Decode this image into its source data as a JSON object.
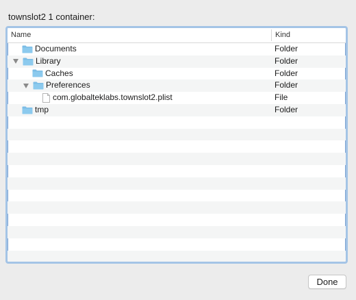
{
  "dialog": {
    "title": "townslot2 1 container:",
    "done_label": "Done"
  },
  "table": {
    "columns": [
      "Name",
      "Kind"
    ],
    "rows": [
      {
        "name": "Documents",
        "kind": "Folder",
        "icon": "folder-icon",
        "expanded": null,
        "depth": 0
      },
      {
        "name": "Library",
        "kind": "Folder",
        "icon": "folder-icon",
        "expanded": true,
        "depth": 0
      },
      {
        "name": "Caches",
        "kind": "Folder",
        "icon": "folder-icon",
        "expanded": null,
        "depth": 1
      },
      {
        "name": "Preferences",
        "kind": "Folder",
        "icon": "folder-icon",
        "expanded": true,
        "depth": 1
      },
      {
        "name": "com.globalteklabs.townslot2.plist",
        "kind": "File",
        "icon": "file-icon",
        "expanded": null,
        "depth": 2
      },
      {
        "name": "tmp",
        "kind": "Folder",
        "icon": "folder-icon",
        "expanded": null,
        "depth": 0
      }
    ]
  },
  "colors": {
    "focus_ring": "#a4c4e6",
    "folder": "#7dbde6",
    "alt_row": "#f4f5f5"
  }
}
